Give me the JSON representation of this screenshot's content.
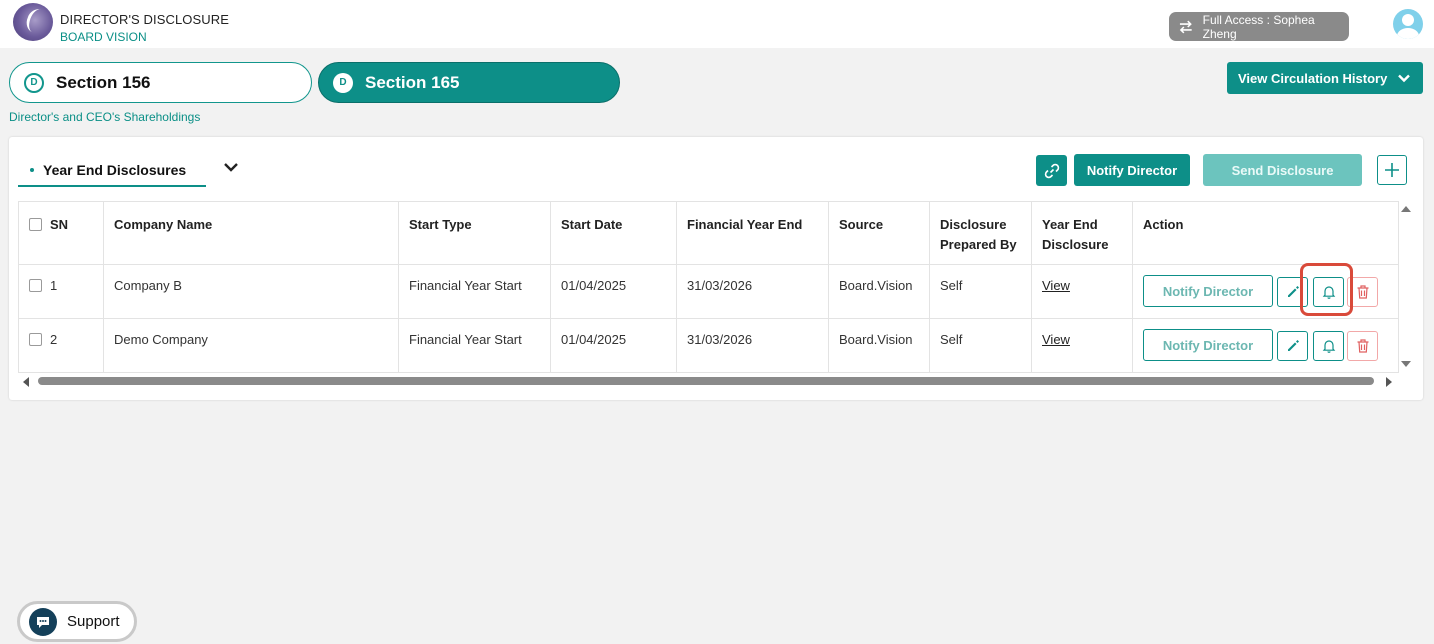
{
  "header": {
    "app_title": "DIRECTOR'S DISCLOSURE",
    "app_subtitle": "BOARD VISION",
    "access_label": "Full Access : Sophea Zheng"
  },
  "sections": {
    "tab1": {
      "badge": "D",
      "label": "Section 156"
    },
    "tab2": {
      "badge": "D",
      "label": "Section 165"
    },
    "caption": "Director's and CEO's Shareholdings",
    "circulation_button": "View Circulation History"
  },
  "toolbar": {
    "tab_label": "Year End Disclosures",
    "notify_label": "Notify Director",
    "send_label": "Send Disclosure"
  },
  "table": {
    "headers": {
      "sn": "SN",
      "company": "Company Name",
      "start_type": "Start Type",
      "start_date": "Start Date",
      "fy_end": "Financial Year End",
      "source": "Source",
      "prepared_by": "Disclosure Prepared By",
      "ye_disclosure": "Year End Disclosure",
      "action": "Action"
    },
    "rows": [
      {
        "sn": "1",
        "company": "Company B",
        "start_type": "Financial Year Start",
        "start_date": "01/04/2025",
        "fy_end": "31/03/2026",
        "source": "Board.Vision",
        "prepared_by": "Self",
        "ye_disclosure": "View",
        "notify": "Notify Director"
      },
      {
        "sn": "2",
        "company": "Demo Company",
        "start_type": "Financial Year Start",
        "start_date": "01/04/2025",
        "fy_end": "31/03/2026",
        "source": "Board.Vision",
        "prepared_by": "Self",
        "ye_disclosure": "View",
        "notify": "Notify Director"
      }
    ]
  },
  "support": {
    "label": "Support"
  },
  "colors": {
    "accent": "#0d8f88",
    "accent_light": "#6cc4be",
    "danger": "#e06060",
    "highlight": "#d94a3a"
  }
}
